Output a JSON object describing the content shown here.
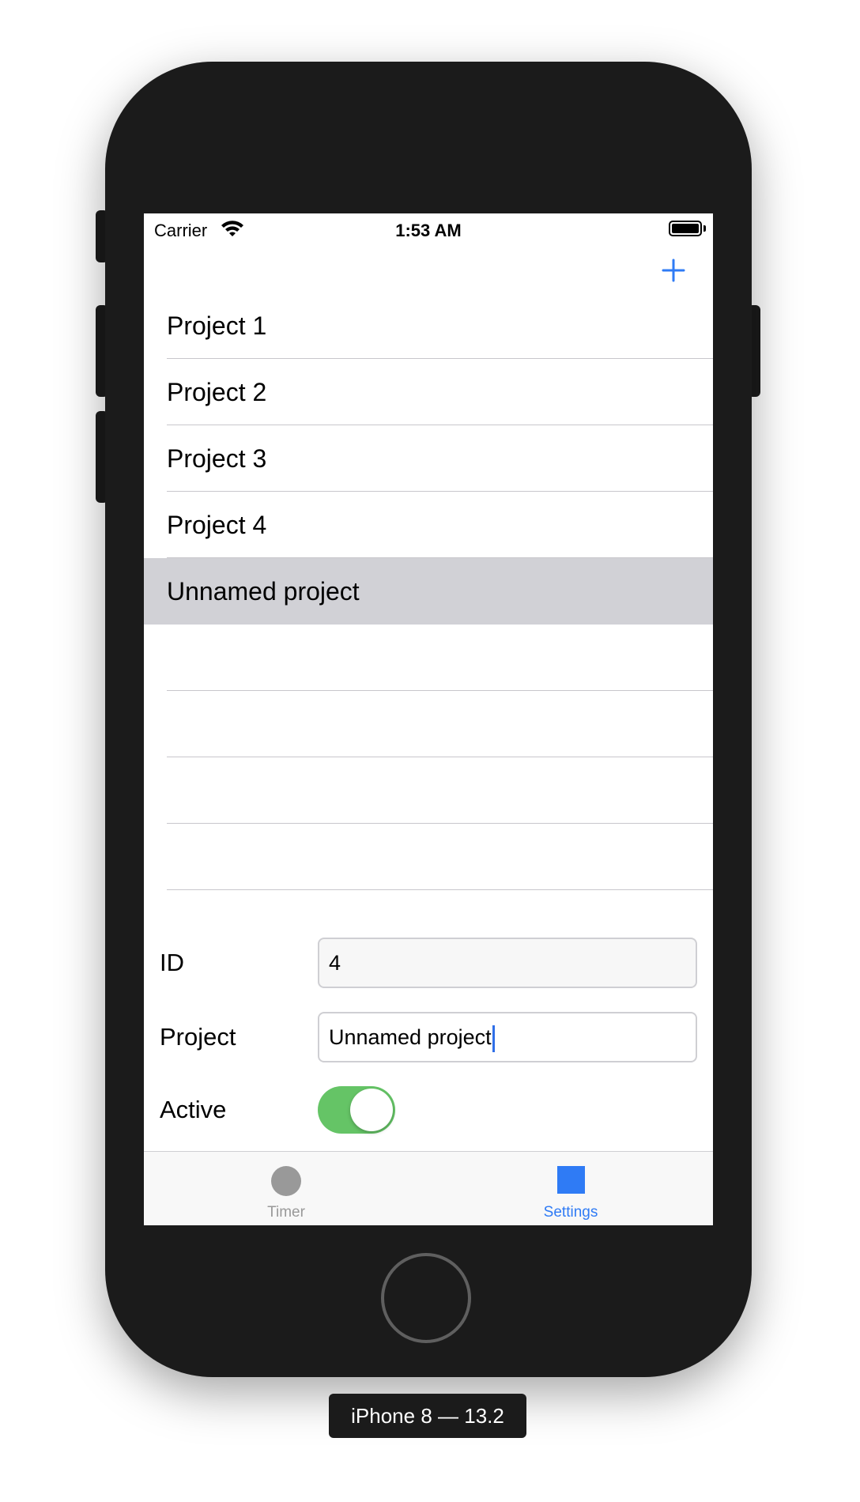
{
  "device": {
    "caption": "iPhone 8 — 13.2"
  },
  "status_bar": {
    "carrier": "Carrier",
    "time": "1:53 AM"
  },
  "toolbar": {
    "add_icon": "plus-icon",
    "accent_color": "#2F7BF5"
  },
  "projects": {
    "items": [
      {
        "label": "Project 1"
      },
      {
        "label": "Project 2"
      },
      {
        "label": "Project 3"
      },
      {
        "label": "Project 4"
      },
      {
        "label": "Unnamed project",
        "selected": true
      }
    ],
    "selected_color": "#D1D1D6"
  },
  "form": {
    "id_label": "ID",
    "id_value": "4",
    "project_label": "Project",
    "project_value": "Unnamed project",
    "active_label": "Active",
    "active_on": true,
    "toggle_color": "#65C466"
  },
  "tabs": [
    {
      "label": "Timer",
      "icon": "circle-icon",
      "selected": false
    },
    {
      "label": "Settings",
      "icon": "square-icon",
      "selected": true
    }
  ]
}
